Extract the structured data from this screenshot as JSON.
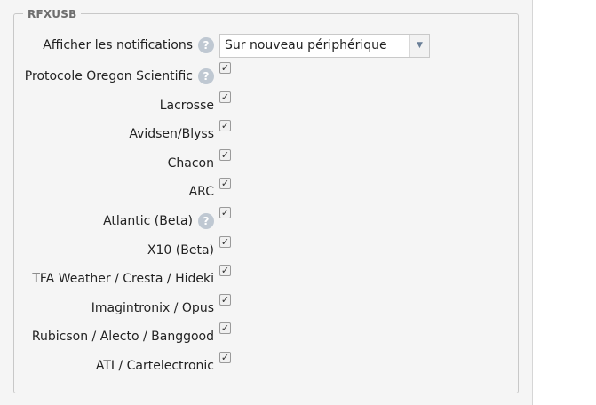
{
  "fieldset": {
    "legend": "RFXUSB"
  },
  "notifications": {
    "label": "Afficher les notifications",
    "selected": "Sur nouveau périphérique"
  },
  "protocols": [
    {
      "label": "Protocole Oregon Scientific",
      "help": true,
      "checked": true
    },
    {
      "label": "Lacrosse",
      "help": false,
      "checked": true
    },
    {
      "label": "Avidsen/Blyss",
      "help": false,
      "checked": true
    },
    {
      "label": "Chacon",
      "help": false,
      "checked": true
    },
    {
      "label": "ARC",
      "help": false,
      "checked": true
    },
    {
      "label": "Atlantic (Beta)",
      "help": true,
      "checked": true
    },
    {
      "label": "X10 (Beta)",
      "help": false,
      "checked": true
    },
    {
      "label": "TFA Weather / Cresta / Hideki",
      "help": false,
      "checked": true
    },
    {
      "label": "Imagintronix / Opus",
      "help": false,
      "checked": true
    },
    {
      "label": "Rubicson / Alecto / Banggood",
      "help": false,
      "checked": true
    },
    {
      "label": "ATI / Cartelectronic",
      "help": false,
      "checked": true
    }
  ],
  "icons": {
    "help": "help-circle-icon",
    "check": "checkmark-icon",
    "dropdown": "chevron-down-icon"
  }
}
